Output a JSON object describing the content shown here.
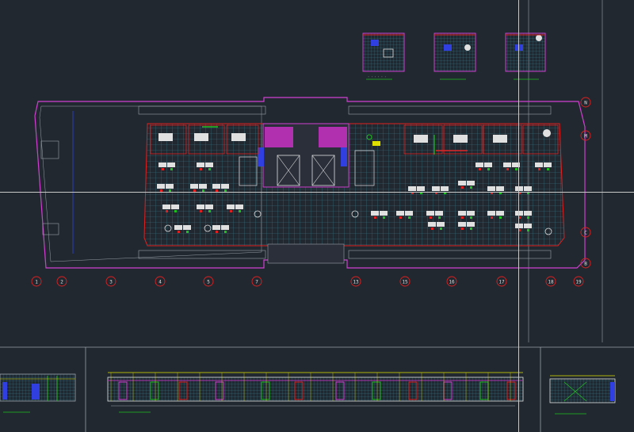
{
  "drawing": {
    "grid_labels_bottom": [
      "1",
      "2",
      "3",
      "4",
      "5",
      "7",
      "13",
      "15",
      "16",
      "17",
      "18",
      "19"
    ],
    "grid_labels_right": [
      "N",
      "M",
      "C",
      "B"
    ],
    "colors": {
      "background": "#212830",
      "wall": "#d040d0",
      "floor_grid": "#3a7a88",
      "furniture": "#e0e0e0",
      "accent_red": "#e02020",
      "accent_green": "#20c020",
      "accent_yellow": "#e0e000",
      "blue": "#3040e0",
      "crosshair": "#c8c8c8"
    }
  }
}
